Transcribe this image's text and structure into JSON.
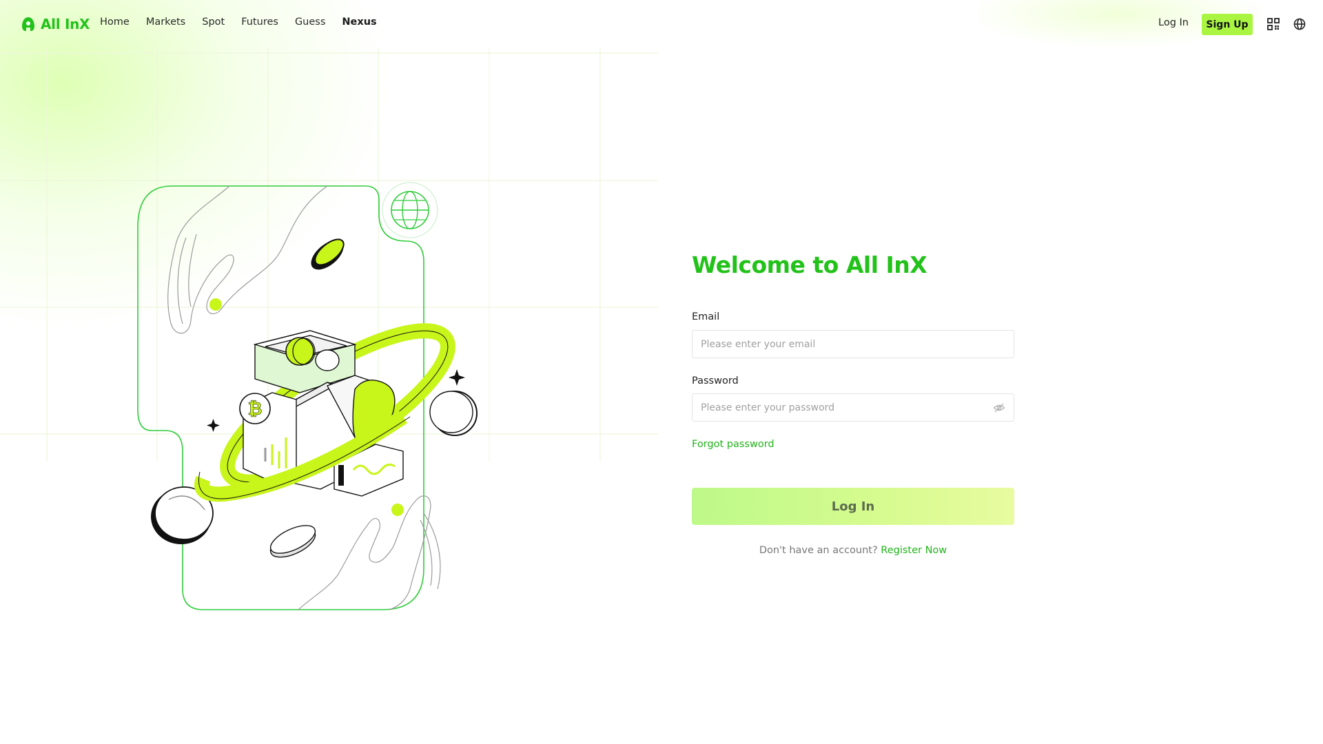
{
  "header": {
    "logo_text": "All InX",
    "nav": [
      {
        "label": "Home"
      },
      {
        "label": "Markets"
      },
      {
        "label": "Spot"
      },
      {
        "label": "Futures"
      },
      {
        "label": "Guess"
      },
      {
        "label": "Nexus"
      }
    ],
    "login_label": "Log In",
    "signup_label": "Sign Up",
    "icons": [
      "qr-code-icon",
      "globe-icon"
    ]
  },
  "form": {
    "title": "Welcome to All InX",
    "email_label": "Email",
    "email_placeholder": "Please enter your email",
    "email_value": "",
    "password_label": "Password",
    "password_placeholder": "Please enter your password",
    "password_value": "",
    "forgot_label": "Forgot password",
    "submit_label": "Log In",
    "no_account_text": "Don't have an account?",
    "register_label": "Register Now"
  },
  "colors": {
    "brand_green": "#22c21a",
    "signup_bg": "#a9f542",
    "accent_lime": "#c8f51a"
  }
}
